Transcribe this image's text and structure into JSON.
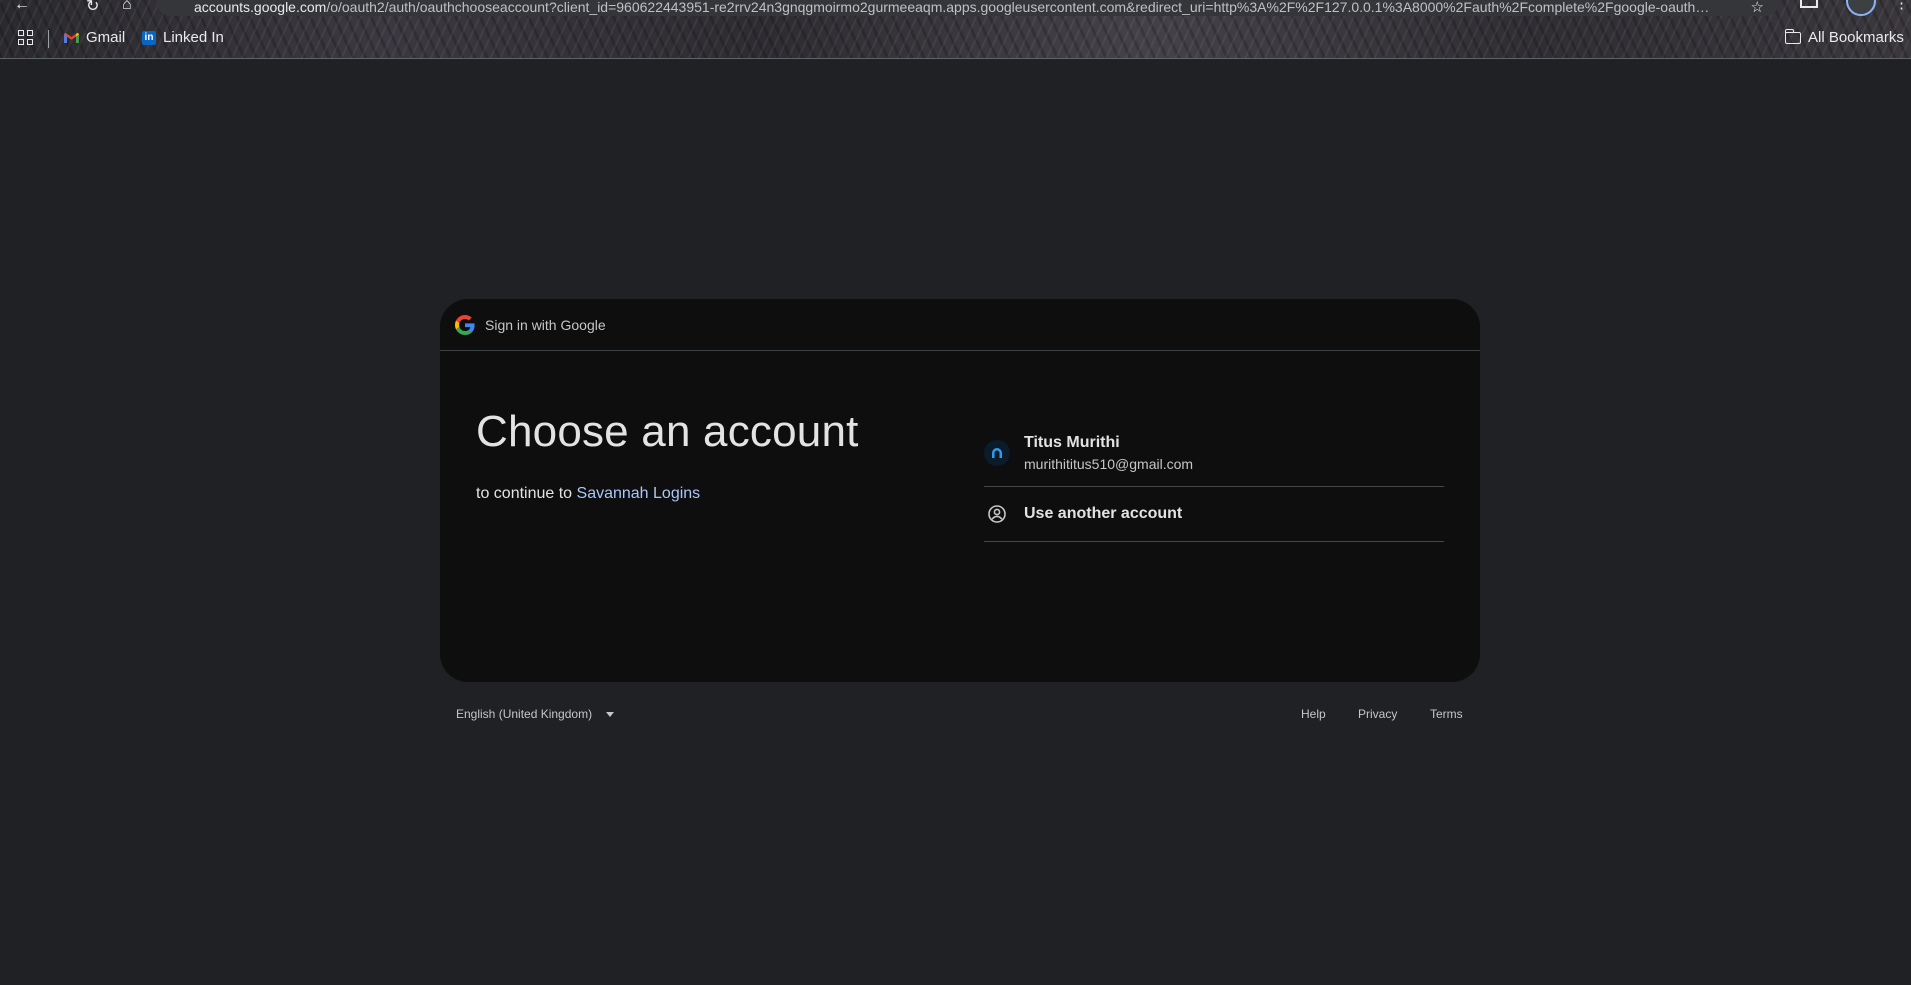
{
  "browser": {
    "url_host": "accounts.google.com",
    "url_rest": "/o/oauth2/auth/oauthchooseaccount?client_id=960622443951-re2rrv24n3gnqgmoirmo2gurmeeaqm.apps.googleusercontent.com&redirect_uri=http%3A%2F%2F127.0.0.1%3A8000%2Fauth%2Fcomplete%2Fgoogle-oauth…",
    "bookmarks": [
      {
        "label": "Gmail",
        "icon": "gmail-icon"
      },
      {
        "label": "Linked In",
        "icon": "linkedin-icon"
      }
    ],
    "all_bookmarks": "All Bookmarks"
  },
  "card": {
    "header": "Sign in with Google",
    "title": "Choose an account",
    "subtitle_prefix": "to continue to ",
    "app_name": "Savannah Logins",
    "accounts": [
      {
        "name": "Titus Murithi",
        "email": "murithititus510@gmail.com"
      }
    ],
    "use_another": "Use another account"
  },
  "footer": {
    "language": "English (United Kingdom)",
    "help": "Help",
    "privacy": "Privacy",
    "terms": "Terms"
  },
  "colors": {
    "page_bg": "#202124",
    "card_bg": "#0e0e0e",
    "link": "#a8c7fa"
  }
}
